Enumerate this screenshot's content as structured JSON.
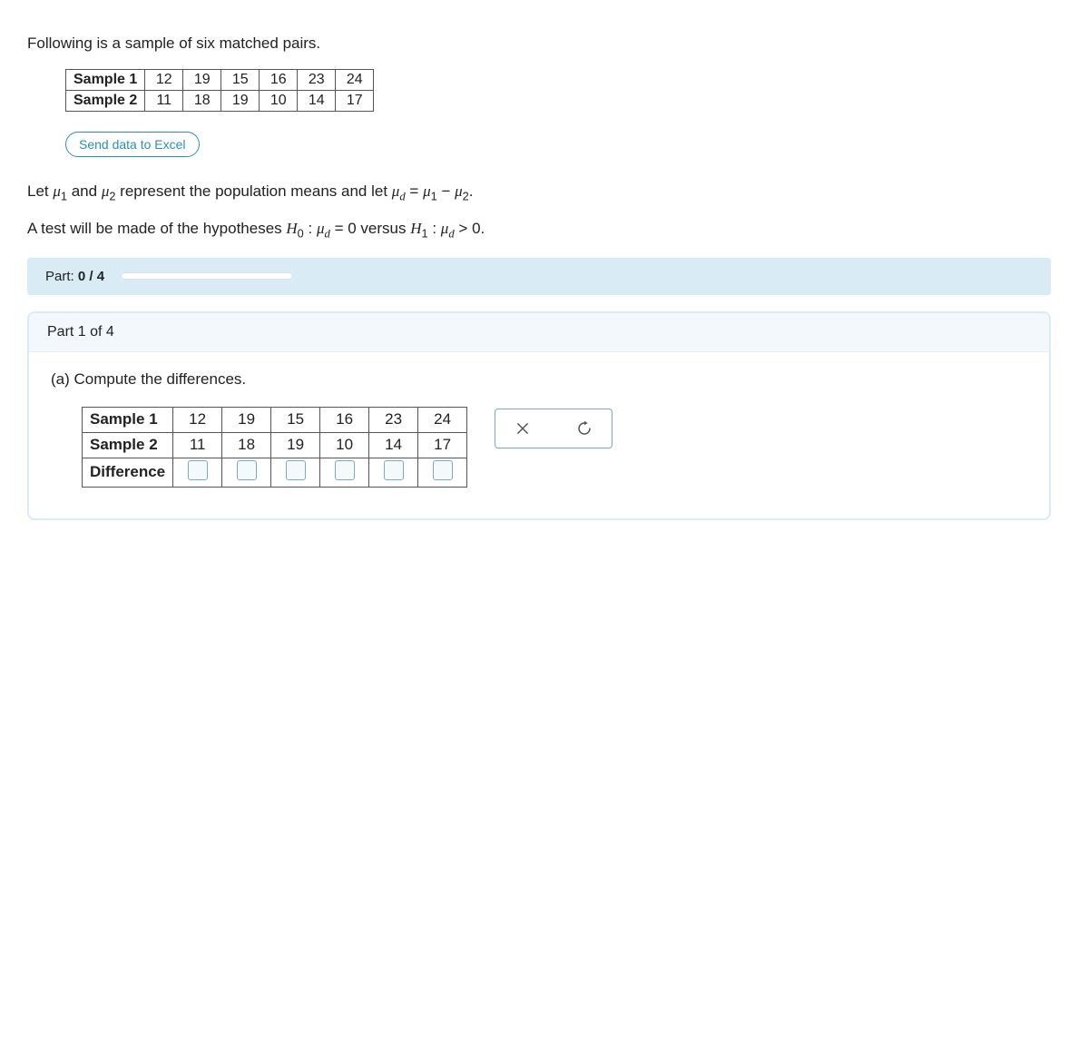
{
  "intro": "Following is a sample of six matched pairs.",
  "top_table": {
    "rows": [
      {
        "label": "Sample 1",
        "values": [
          "12",
          "19",
          "15",
          "16",
          "23",
          "24"
        ]
      },
      {
        "label": "Sample 2",
        "values": [
          "11",
          "18",
          "19",
          "10",
          "14",
          "17"
        ]
      }
    ]
  },
  "excel_button": "Send data to Excel",
  "let_line_pre": "Let ",
  "let_line_mid": " represent the population means and let ",
  "hypothesis_pre": "A test will be made of the hypotheses ",
  "hypothesis_mid": " versus ",
  "progress": {
    "label_prefix": "Part: ",
    "done": "0",
    "total": "4",
    "percent": 5
  },
  "part_header": "Part 1 of 4",
  "question": "(a) Compute the differences.",
  "ans_table": {
    "rows": [
      {
        "label": "Sample 1",
        "values": [
          "12",
          "19",
          "15",
          "16",
          "23",
          "24"
        ]
      },
      {
        "label": "Sample 2",
        "values": [
          "11",
          "18",
          "19",
          "10",
          "14",
          "17"
        ]
      }
    ],
    "diff_label": "Difference"
  },
  "icons": {
    "close": "close-icon",
    "reset": "reset-icon"
  }
}
